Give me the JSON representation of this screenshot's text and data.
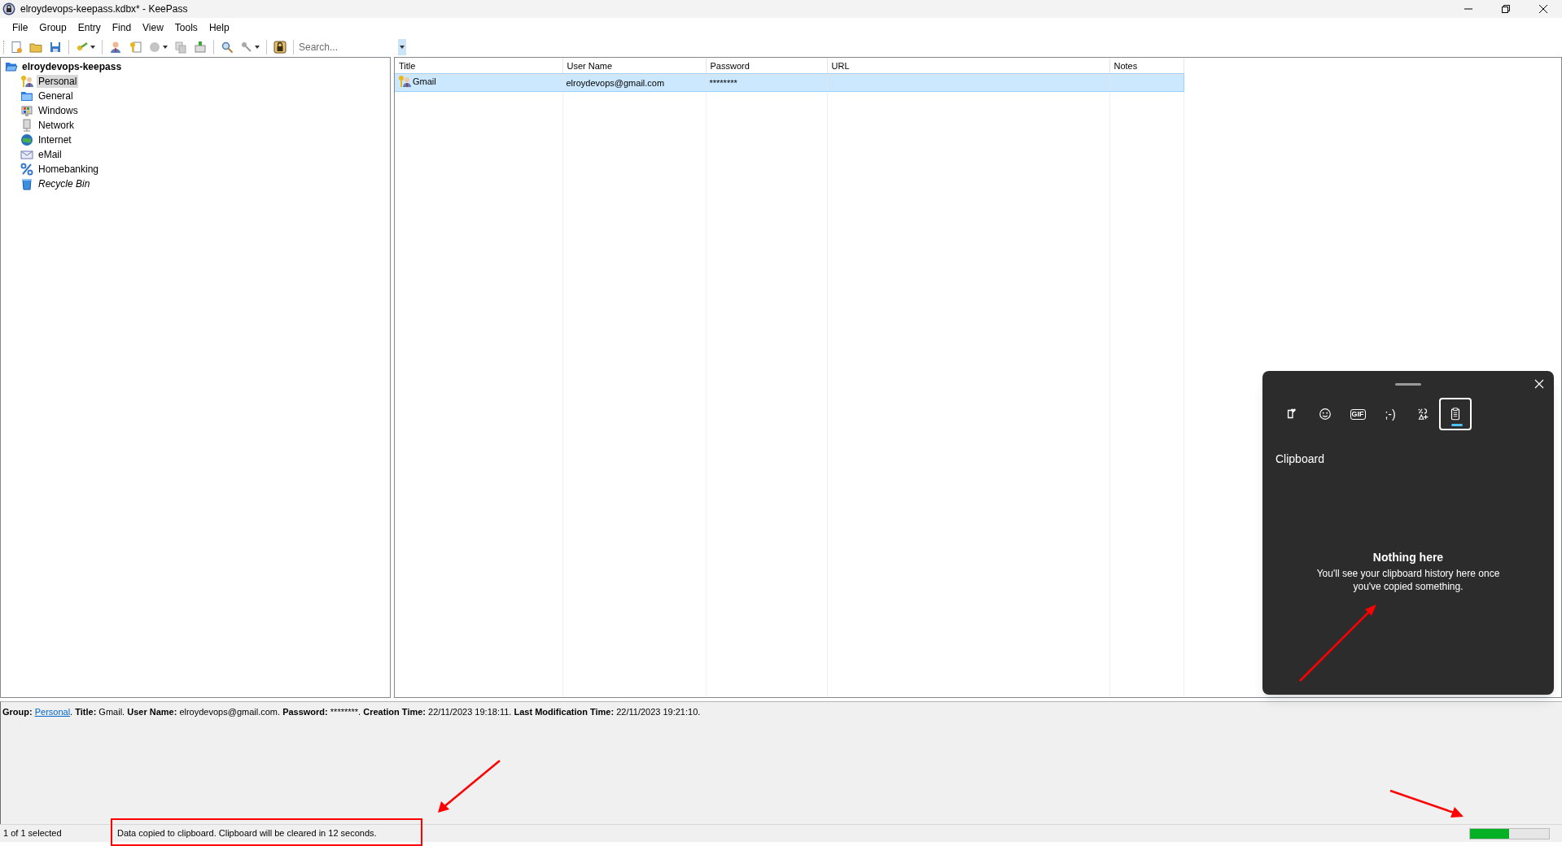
{
  "window": {
    "title": "elroydevops-keepass.kdbx* - KeePass"
  },
  "menu": [
    "File",
    "Group",
    "Entry",
    "Find",
    "View",
    "Tools",
    "Help"
  ],
  "toolbar": {
    "search": {
      "placeholder": "Search..."
    }
  },
  "tree": {
    "label": "elroydevops-keepass",
    "children": [
      {
        "label": "Personal",
        "kind": "personal",
        "selected": true
      },
      {
        "label": "General",
        "kind": "folder",
        "selected": false
      },
      {
        "label": "Windows",
        "kind": "windows",
        "selected": false
      },
      {
        "label": "Network",
        "kind": "network",
        "selected": false
      },
      {
        "label": "Internet",
        "kind": "internet",
        "selected": false
      },
      {
        "label": "eMail",
        "kind": "email",
        "selected": false
      },
      {
        "label": "Homebanking",
        "kind": "homebanking",
        "selected": false
      },
      {
        "label": "Recycle Bin",
        "kind": "recycle_bin",
        "selected": false
      }
    ]
  },
  "table": {
    "columns": [
      "Title",
      "User Name",
      "Password",
      "URL",
      "Notes"
    ],
    "rows": [
      {
        "title": "Gmail",
        "user_name": "elroydevops@gmail.com",
        "password": "********",
        "selected": true
      }
    ]
  },
  "details": [
    {
      "kind": "label",
      "text": "Group:"
    },
    {
      "kind": "link",
      "text": "Personal"
    },
    {
      "kind": "text",
      "text": ". "
    },
    {
      "kind": "label",
      "text": "Title:"
    },
    {
      "kind": "text",
      "text": " Gmail. "
    },
    {
      "kind": "label",
      "text": "User Name:"
    },
    {
      "kind": "text",
      "text": " elroydevops@gmail.com. "
    },
    {
      "kind": "label",
      "text": "Password:"
    },
    {
      "kind": "text",
      "text": " ********. "
    },
    {
      "kind": "label",
      "text": "Creation Time:"
    },
    {
      "kind": "text",
      "text": " 22/11/2023 19:18:11. "
    },
    {
      "kind": "label",
      "text": "Last Modification Time:"
    },
    {
      "kind": "text",
      "text": " 22/11/2023 19:21:10."
    }
  ],
  "status_bar": {
    "selection": "1 of 1 selected",
    "message": "Data copied to clipboard. Clipboard will be cleared in 12 seconds.",
    "progress": {
      "level": 0.49
    }
  },
  "clipboard_panel": {
    "tabs": [
      {
        "kind": "favorites",
        "selected": false
      },
      {
        "kind": "emoji",
        "selected": false
      },
      {
        "kind": "gif",
        "label": "GIF",
        "selected": false
      },
      {
        "kind": "kaomoji",
        "label": ";-)",
        "selected": false
      },
      {
        "kind": "symbols",
        "selected": false
      },
      {
        "kind": "clipboard",
        "selected": true
      }
    ],
    "heading": "Clipboard",
    "empty_title": "Nothing here",
    "empty_text": "You'll see your clipboard history here once you've copied something."
  }
}
